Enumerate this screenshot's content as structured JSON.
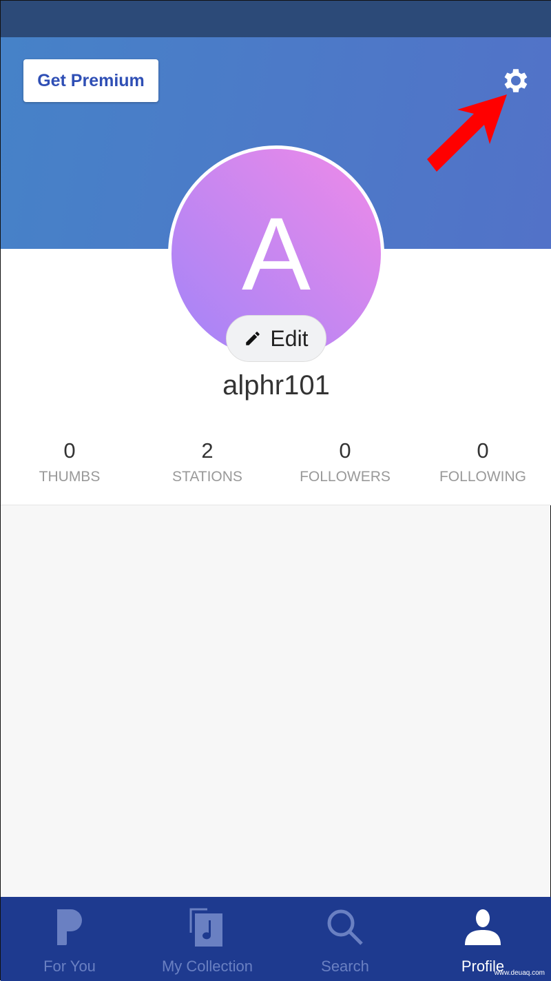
{
  "header": {
    "premium_label": "Get Premium",
    "settings_icon": "gear-icon"
  },
  "profile": {
    "avatar_letter": "A",
    "edit_label": "Edit",
    "username": "alphr101"
  },
  "stats": [
    {
      "value": "0",
      "label": "THUMBS"
    },
    {
      "value": "2",
      "label": "STATIONS"
    },
    {
      "value": "0",
      "label": "FOLLOWERS"
    },
    {
      "value": "0",
      "label": "FOLLOWING"
    }
  ],
  "nav": [
    {
      "label": "For You",
      "icon": "pandora-icon"
    },
    {
      "label": "My Collection",
      "icon": "collection-icon"
    },
    {
      "label": "Search",
      "icon": "search-icon"
    },
    {
      "label": "Profile",
      "icon": "person-icon",
      "active": true
    }
  ],
  "watermark": "www.deuaq.com",
  "colors": {
    "nav_bg": "#1e3a8f",
    "accent": "#2f4fb5",
    "annotation_arrow": "#ff0000"
  }
}
